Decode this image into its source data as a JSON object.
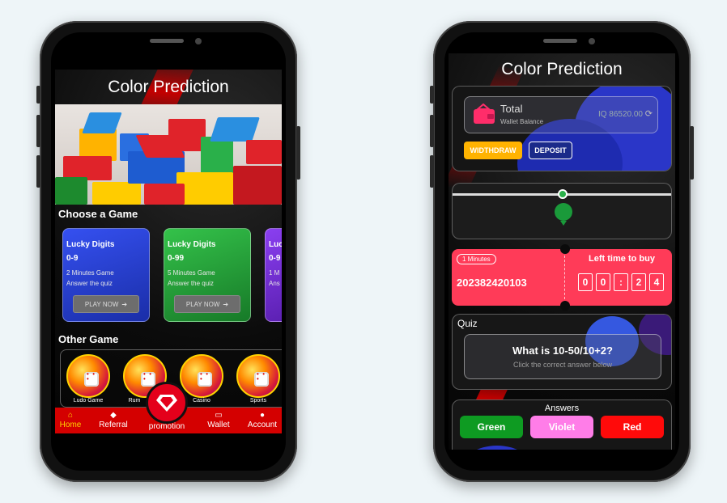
{
  "left_screen": {
    "title": "Color Prediction",
    "choose_label": "Choose a Game",
    "games": [
      {
        "title": "Lucky Digits",
        "range": "0-9",
        "line1": "2 Minutes Game",
        "line2": "Answer the quiz",
        "button": "PLAY NOW",
        "color": "#2a3fd6"
      },
      {
        "title": "Lucky Digits",
        "range": "0-99",
        "line1": "5 Minutes Game",
        "line2": "Answer the quiz",
        "button": "PLAY NOW",
        "color": "#26a63a"
      },
      {
        "title": "Luc",
        "range": "0-9",
        "line1": "1 M",
        "line2": "Ans",
        "button": "",
        "color": "#7a2fd6"
      }
    ],
    "other_label": "Other Game",
    "other_games": [
      "Ludo Game",
      "Rum",
      "Casino",
      "Sports"
    ],
    "nav": [
      {
        "label": "Home",
        "icon": "home-icon",
        "active": true
      },
      {
        "label": "Referral",
        "icon": "tag-icon",
        "active": false
      },
      {
        "label": "promotion",
        "icon": "diamond-icon",
        "active": false
      },
      {
        "label": "Wallet",
        "icon": "wallet-icon",
        "active": false
      },
      {
        "label": "Account",
        "icon": "user-icon",
        "active": false
      }
    ]
  },
  "right_screen": {
    "title": "Color Prediction",
    "wallet": {
      "title": "Total",
      "subtitle": "Wallet Balance",
      "amount": "IQ 86520.00",
      "withdraw_label": "WIDTHDRAW",
      "deposit_label": "DEPOSIT"
    },
    "round": {
      "duration": "1 Minutes",
      "period_id": "202382420103",
      "time_label": "Left time to buy",
      "digits": [
        "0",
        "0",
        ":",
        "2",
        "4"
      ]
    },
    "quiz": {
      "label": "Quiz",
      "question": "What is 10-50/10+2?",
      "hint": "Click the correct answer below"
    },
    "answers": {
      "label": "Answers",
      "options": [
        {
          "label": "Green",
          "color": "#0e9b22"
        },
        {
          "label": "Violet",
          "color": "#ff7de8"
        },
        {
          "label": "Red",
          "color": "#ff0a0a"
        }
      ]
    }
  },
  "colors": {
    "accent_red": "#d40000",
    "withdraw_orange": "#ffb300",
    "deposit_navy": "#1b2a8a",
    "timer_red": "#ff3b58"
  }
}
